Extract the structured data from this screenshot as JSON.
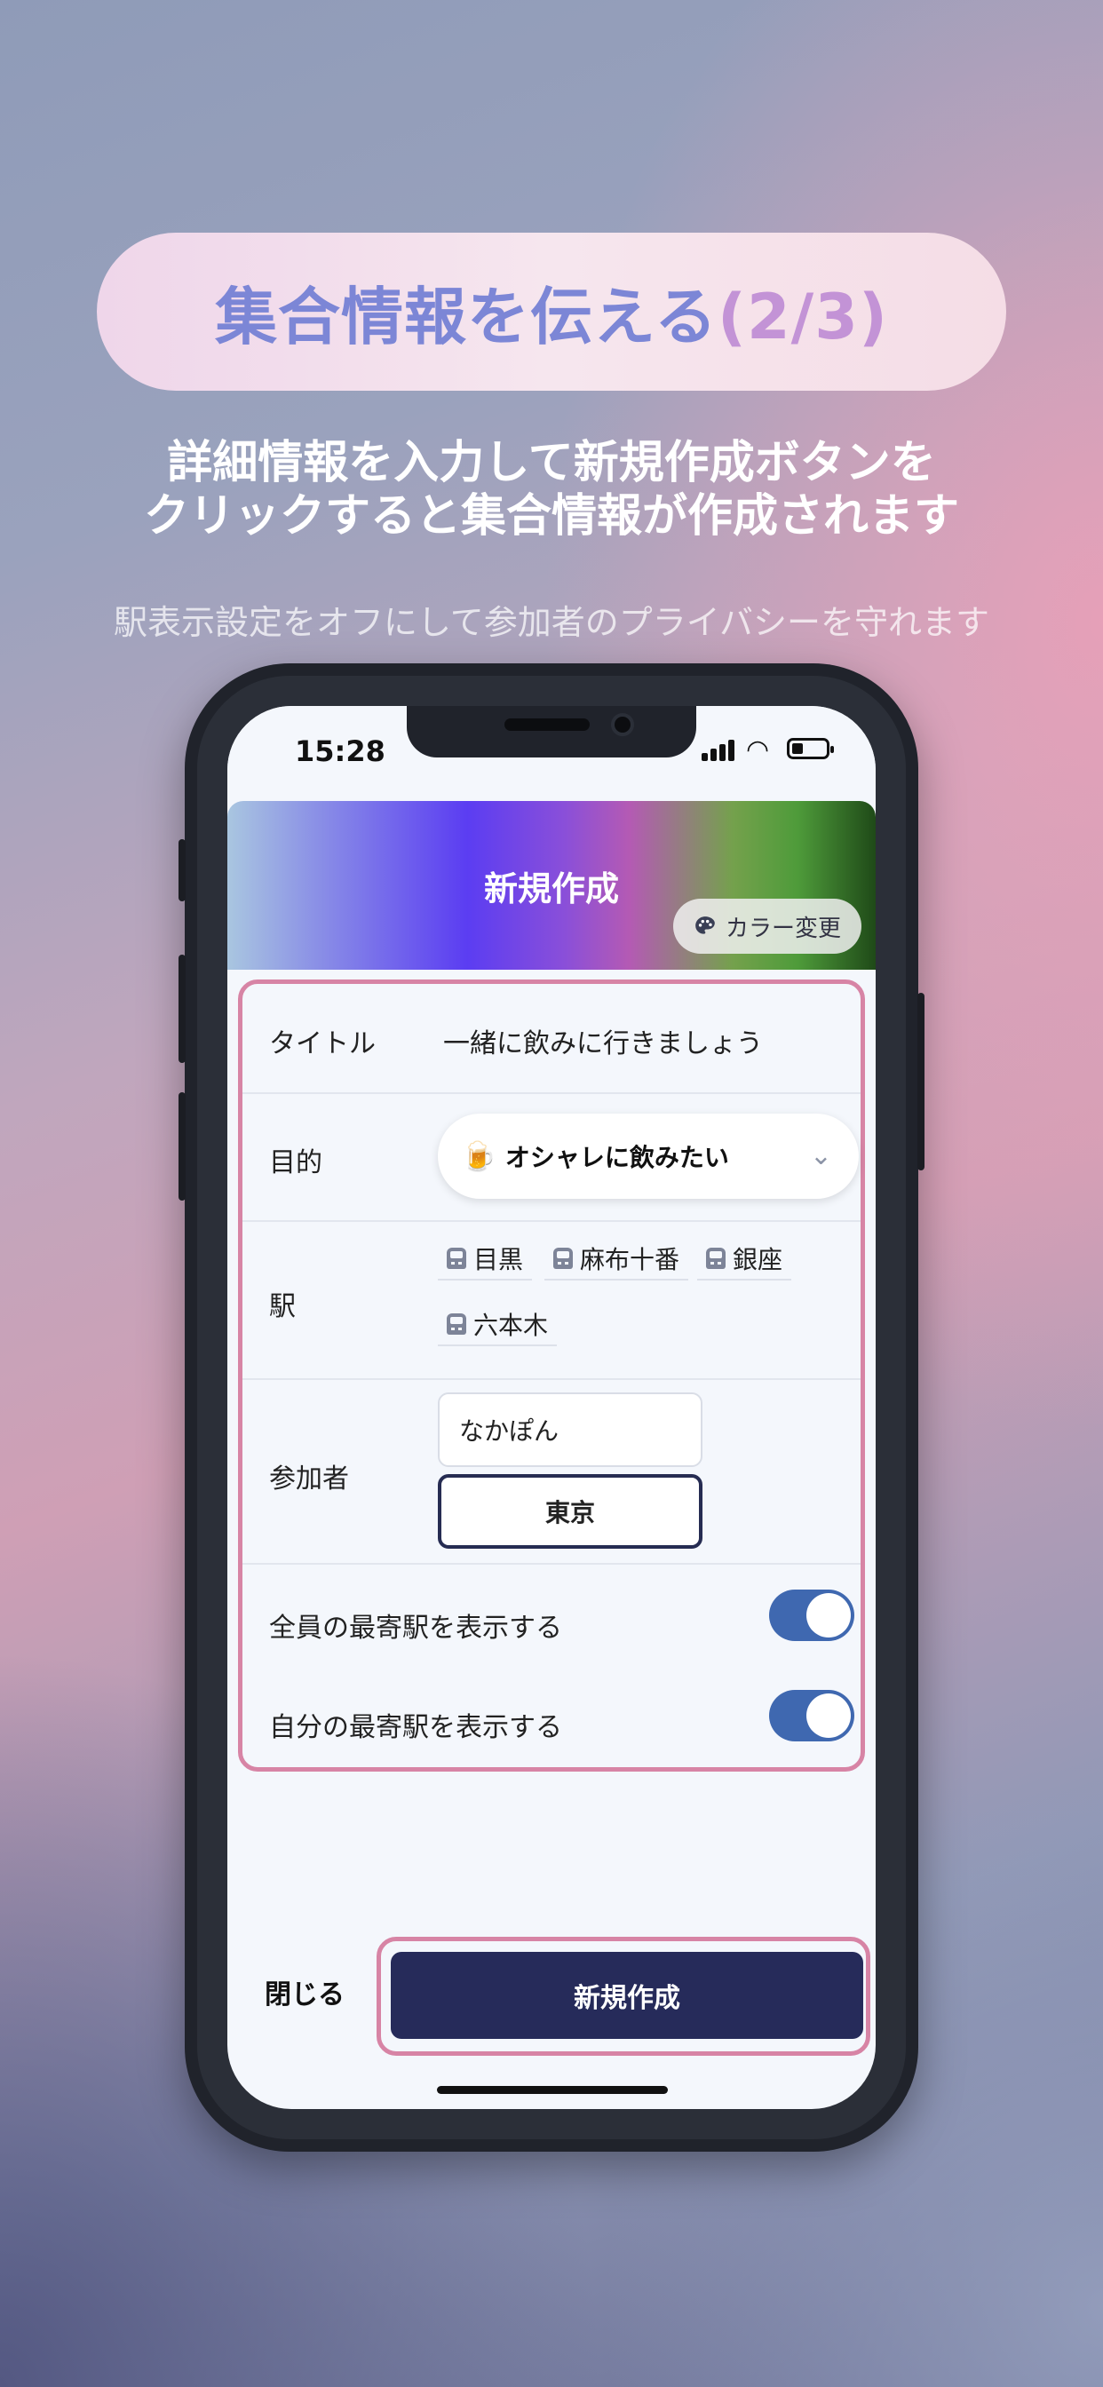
{
  "headline": {
    "main": "集合情報を伝える",
    "step": "(2/3)"
  },
  "subheadline": {
    "line1": "詳細情報を入力して新規作成ボタンを",
    "line2": "クリックすると集合情報が作成されます"
  },
  "note": "駅表示設定をオフにして参加者のプライバシーを守れます",
  "status_bar": {
    "time": "15:28"
  },
  "modal_header": {
    "title": "新規作成",
    "color_button_label": "カラー変更",
    "gradient_colors": [
      "#a9c6e0",
      "#5b3df2",
      "#b45ab4",
      "#4e9b3a",
      "#1f4a18"
    ]
  },
  "form": {
    "title_label": "タイトル",
    "title_value": "一緒に飲みに行きましょう",
    "purpose_label": "目的",
    "purpose_emoji": "🍺",
    "purpose_value": "オシャレに飲みたい",
    "station_label": "駅",
    "stations": [
      "目黒",
      "麻布十番",
      "銀座",
      "六本木"
    ],
    "participants_label": "参加者",
    "participant_name": "なかぽん",
    "participant_station": "東京",
    "toggle_all_label": "全員の最寄駅を表示する",
    "toggle_all_on": true,
    "toggle_self_label": "自分の最寄駅を表示する",
    "toggle_self_on": true
  },
  "footer": {
    "close_label": "閉じる",
    "create_label": "新規作成"
  },
  "colors": {
    "accent_pink": "#d784a5",
    "primary_navy": "#262b5a",
    "toggle_blue": "#3f68b0"
  }
}
